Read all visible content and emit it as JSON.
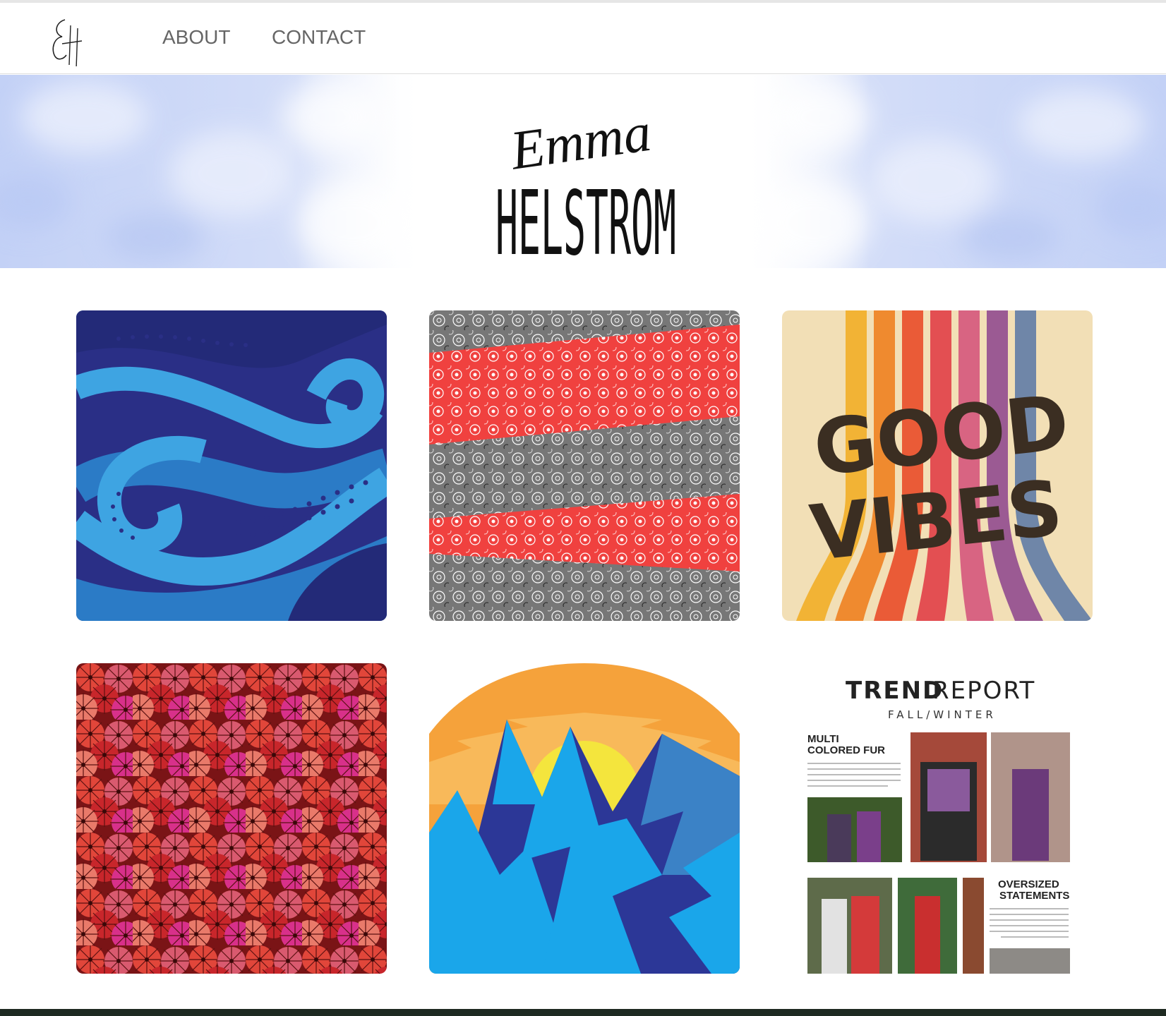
{
  "nav": {
    "logo_alt": "EH",
    "about_label": "ABOUT",
    "contact_label": "CONTACT"
  },
  "hero": {
    "script_name": "Emma",
    "surname": "HELSTROM",
    "cloud_color": "#c9d6f8"
  },
  "gallery": {
    "tiles": [
      {
        "name": "octopus-tentacles-artwork",
        "icon": "tentacle-pattern"
      },
      {
        "name": "red-floral-stripes-artwork",
        "icon": "floral-stripe-pattern"
      },
      {
        "name": "good-vibes-artwork",
        "line1": "GOOD",
        "line2": "VIBES"
      },
      {
        "name": "hibiscus-pattern-artwork",
        "icon": "flower-pattern"
      },
      {
        "name": "mountain-sunset-artwork",
        "icon": "mountain-illustration"
      },
      {
        "name": "trend-report-artwork",
        "title_bold": "TREND",
        "title_light": "REPORT",
        "subtitle": "FALL/WINTER",
        "section1": [
          "MULTI",
          "COLORED FUR"
        ],
        "section2": [
          "OVERSIZED",
          "STATEMENTS"
        ]
      }
    ]
  }
}
